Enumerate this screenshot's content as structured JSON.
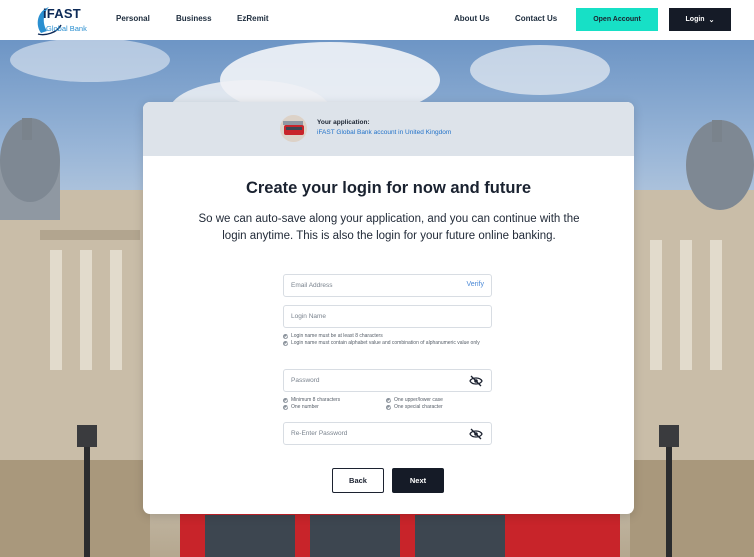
{
  "header": {
    "logo_text": "iFAST",
    "logo_sub": "Global Bank",
    "nav_left": [
      "Personal",
      "Business",
      "EzRemit"
    ],
    "nav_right": [
      "About Us",
      "Contact Us"
    ],
    "open_account": "Open Account",
    "login": "Login"
  },
  "application": {
    "label": "Your application:",
    "value": "iFAST Global Bank account in United Kingdom"
  },
  "form": {
    "title": "Create your login for now and future",
    "subtitle": "So we can auto-save along your application, and you can continue with the login anytime. This is also the login for your future online banking.",
    "email_placeholder": "Email Address",
    "verify_label": "Verify",
    "login_name_placeholder": "Login Name",
    "login_hints": [
      "Login name must be at least 8 characters",
      "Login name must contain alphabet value and combination of alphanumeric value only"
    ],
    "password_placeholder": "Password",
    "password_hints": [
      "Minimum 8 characters",
      "One number",
      "One upper/lower case",
      "One special character"
    ],
    "reenter_placeholder": "Re-Enter Password",
    "back_label": "Back",
    "next_label": "Next"
  },
  "colors": {
    "accent": "#17e0c6",
    "dark": "#151b27",
    "link": "#2373c9"
  }
}
